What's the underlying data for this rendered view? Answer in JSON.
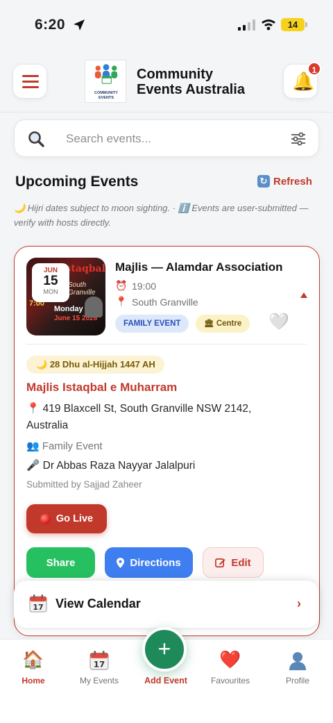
{
  "status_bar": {
    "time": "6:20",
    "battery": "14"
  },
  "header": {
    "title_line1": "Community",
    "title_line2": "Events Australia",
    "logo_caption_line1": "COMMUNITY",
    "logo_caption_line2": "EVENTS",
    "notification_count": "1"
  },
  "search": {
    "placeholder": "Search events..."
  },
  "section": {
    "title": "Upcoming Events",
    "refresh_label": "Refresh",
    "notice": "🌙 Hijri dates subject to moon sighting. · ℹ️ Events are user-submitted — verify with hosts directly."
  },
  "event": {
    "date_month": "JUN",
    "date_day": "15",
    "date_weekday": "MON",
    "title": "Majlis — Alamdar Association",
    "time": "19:00",
    "place": "South Granville",
    "tag_type": "FAMILY EVENT",
    "tag_venue": "Centre",
    "hijri_date": "28 Dhu al-Hijjah 1447 AH",
    "subtitle": "Majlis Istaqbal e Muharram",
    "address": "419 Blaxcell St, South Granville NSW 2142, Australia",
    "category": "Family Event",
    "speaker": "Dr Abbas Raza Nayyar Jalalpuri",
    "submitted_by": "Submitted by Sajjad Zaheer",
    "go_live_label": "Go Live",
    "share_label": "Share",
    "directions_label": "Directions",
    "edit_label": "Edit",
    "poster_text": {
      "heading": "Istaqbal",
      "venue": "South Granville",
      "time": "7:00",
      "day": "Monday",
      "date": "June 15 2026"
    }
  },
  "calendar_bar": {
    "label": "View Calendar",
    "chevron": "›"
  },
  "tabbar": {
    "home": "Home",
    "my_events": "My Events",
    "add_event": "Add Event",
    "favourites": "Favourites",
    "profile": "Profile"
  },
  "colors": {
    "accent": "#c0392b",
    "add_button": "#1e8a5a",
    "share_green": "#26c060",
    "directions_blue": "#3f7ef0"
  }
}
